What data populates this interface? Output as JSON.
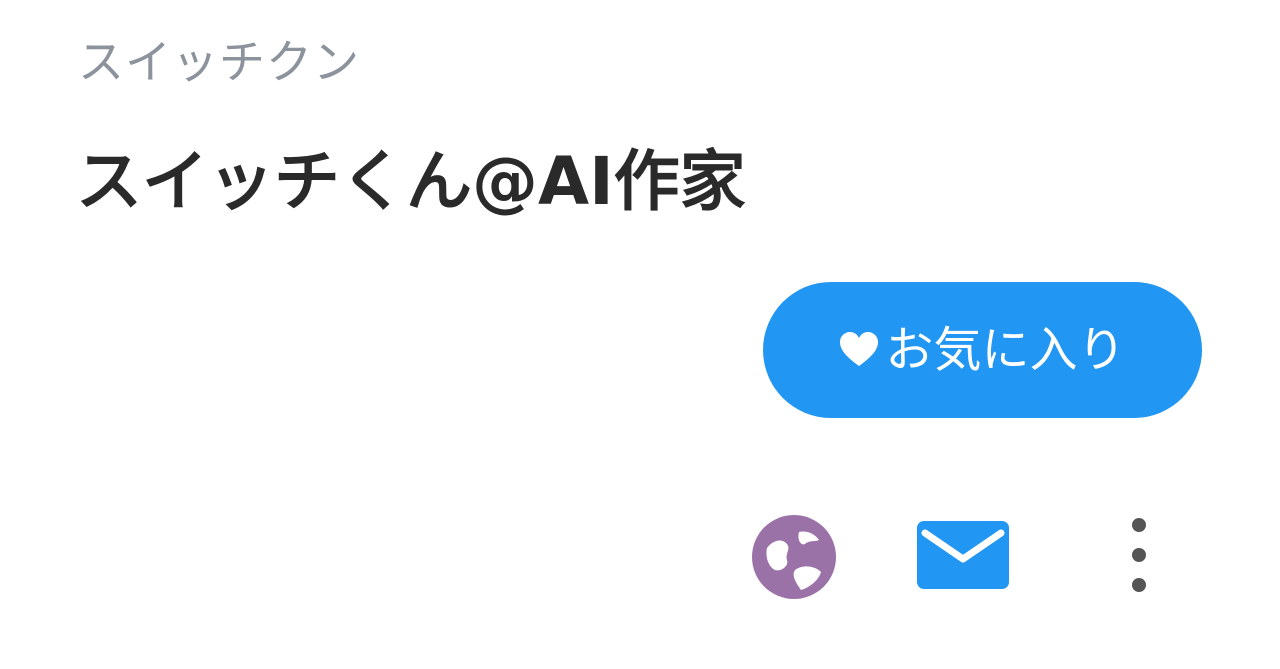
{
  "profile": {
    "reading": "スイッチクン",
    "display_name": "スイッチくん@AI作家"
  },
  "actions": {
    "favorite_label": "お気に入り",
    "favorite_icon": "heart-icon",
    "website_icon": "globe-icon",
    "message_icon": "mail-icon",
    "more_icon": "more-vertical-icon"
  },
  "colors": {
    "accent": "#2196f3",
    "globe": "#9b72a8",
    "more": "#555555",
    "reading_text": "#8c939c",
    "name_text": "#2a2a2a"
  }
}
